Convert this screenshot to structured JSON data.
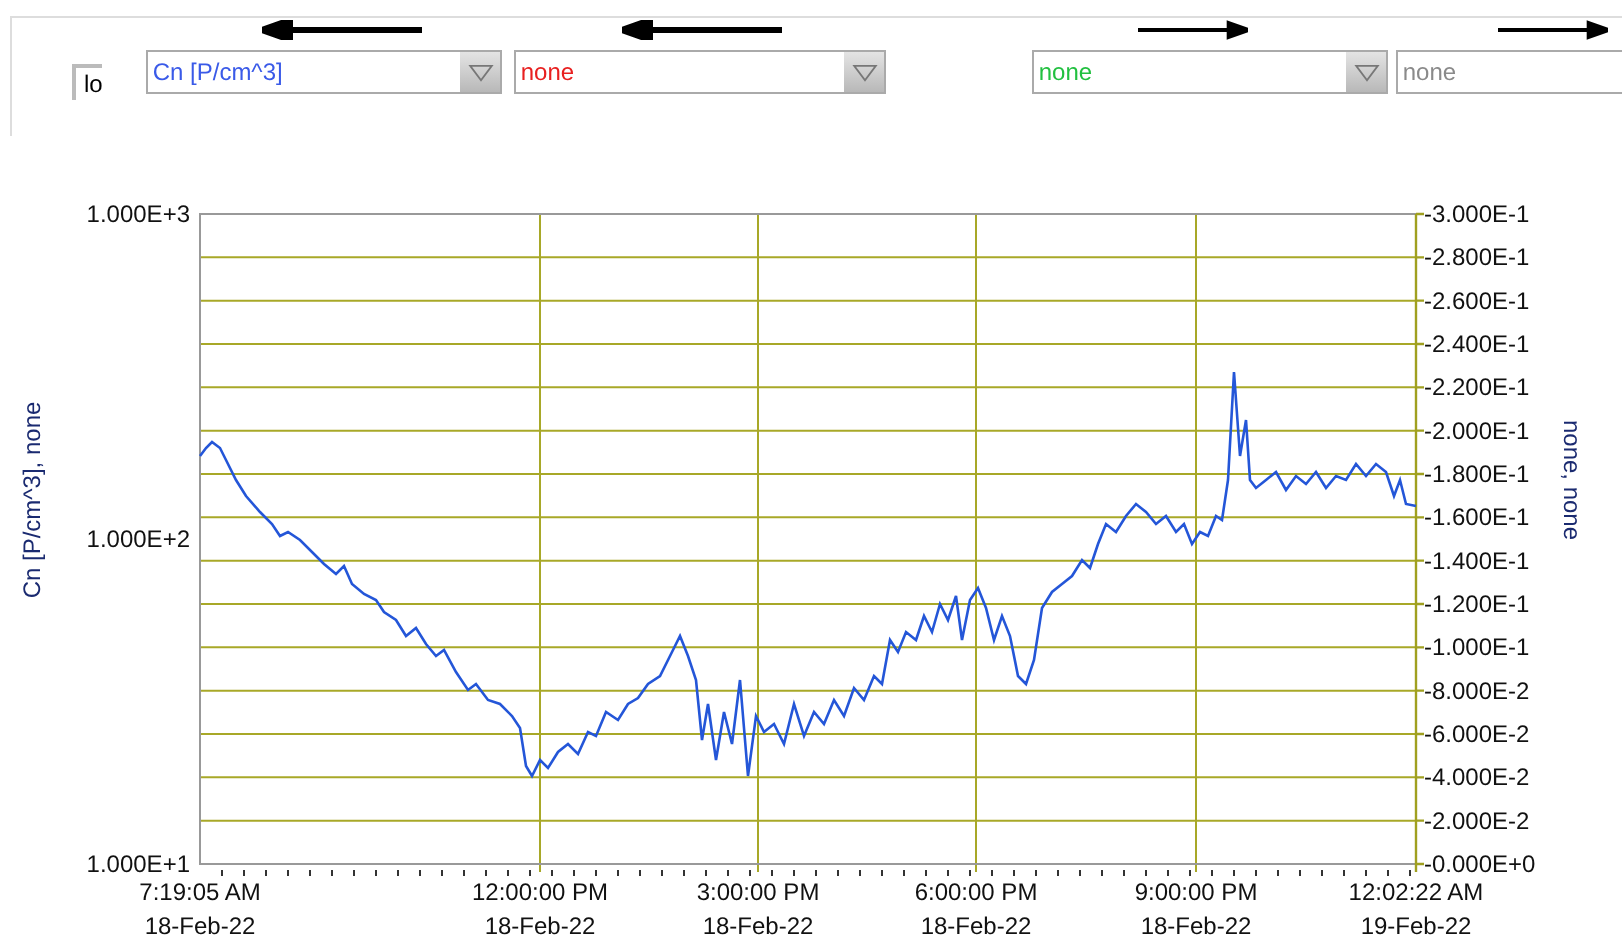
{
  "unit_box": {
    "value": "lo"
  },
  "selectors": [
    {
      "value": "Cn [P/cm^3]",
      "color": "#3a5ae8",
      "kind": "left",
      "disabled": false
    },
    {
      "value": "none",
      "color": "#e82020",
      "kind": "left",
      "disabled": false
    },
    {
      "value": "none",
      "color": "#22c040",
      "kind": "right",
      "disabled": false
    },
    {
      "value": "none",
      "color": "#8a8a8a",
      "kind": "right",
      "disabled": true
    }
  ],
  "plot": {
    "left_axis": {
      "label": "Cn [P/cm^3], none",
      "ticks": [
        "1.000E+3",
        "1.000E+2",
        "1.000E+1"
      ]
    },
    "right_axis": {
      "label": "none, none",
      "ticks": [
        "-3.000E-1",
        "-2.800E-1",
        "-2.600E-1",
        "-2.400E-1",
        "-2.200E-1",
        "-2.000E-1",
        "-1.800E-1",
        "-1.600E-1",
        "-1.400E-1",
        "-1.200E-1",
        "-1.000E-1",
        "-8.000E-2",
        "-6.000E-2",
        "-4.000E-2",
        "-2.000E-2",
        "-0.000E+0"
      ]
    },
    "time_axis": {
      "ticks": [
        {
          "time": "7:19:05 AM",
          "date": "18-Feb-22"
        },
        {
          "time": "12:00:00 PM",
          "date": "18-Feb-22"
        },
        {
          "time": "3:00:00 PM",
          "date": "18-Feb-22"
        },
        {
          "time": "6:00:00 PM",
          "date": "18-Feb-22"
        },
        {
          "time": "9:00:00 PM",
          "date": "18-Feb-22"
        },
        {
          "time": "12:02:22 AM",
          "date": "19-Feb-22"
        }
      ]
    }
  }
}
